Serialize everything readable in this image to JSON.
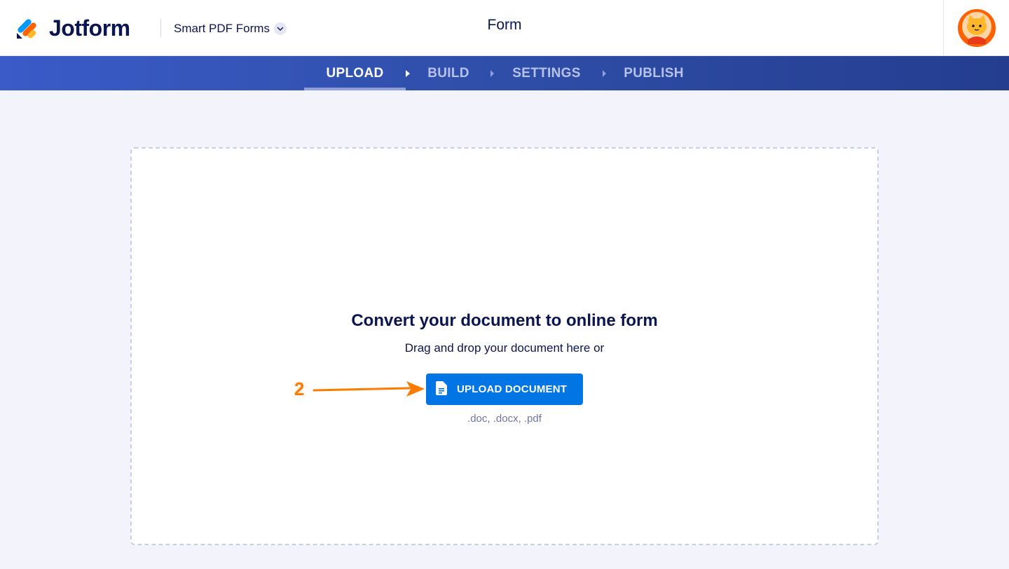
{
  "header": {
    "brand": "Jotform",
    "product": "Smart PDF Forms",
    "title": "Form"
  },
  "nav": {
    "tabs": [
      {
        "label": "UPLOAD",
        "active": true
      },
      {
        "label": "BUILD",
        "active": false
      },
      {
        "label": "SETTINGS",
        "active": false
      },
      {
        "label": "PUBLISH",
        "active": false
      }
    ]
  },
  "upload": {
    "title": "Convert your document to online form",
    "subtitle": "Drag and drop your document here or",
    "button_label": "UPLOAD DOCUMENT",
    "formats": ".doc, .docx, .pdf"
  },
  "annotation": {
    "step": "2"
  },
  "colors": {
    "accent": "#0075e3",
    "brand_navy": "#0a1551",
    "annotation": "#ff7a00",
    "avatar": "#ff6100"
  },
  "icons": {
    "logo": "jotform-logo-icon",
    "chevron": "chevron-down-icon",
    "tab_separator": "caret-right-icon",
    "upload": "document-icon",
    "avatar": "cat-avatar-icon"
  }
}
